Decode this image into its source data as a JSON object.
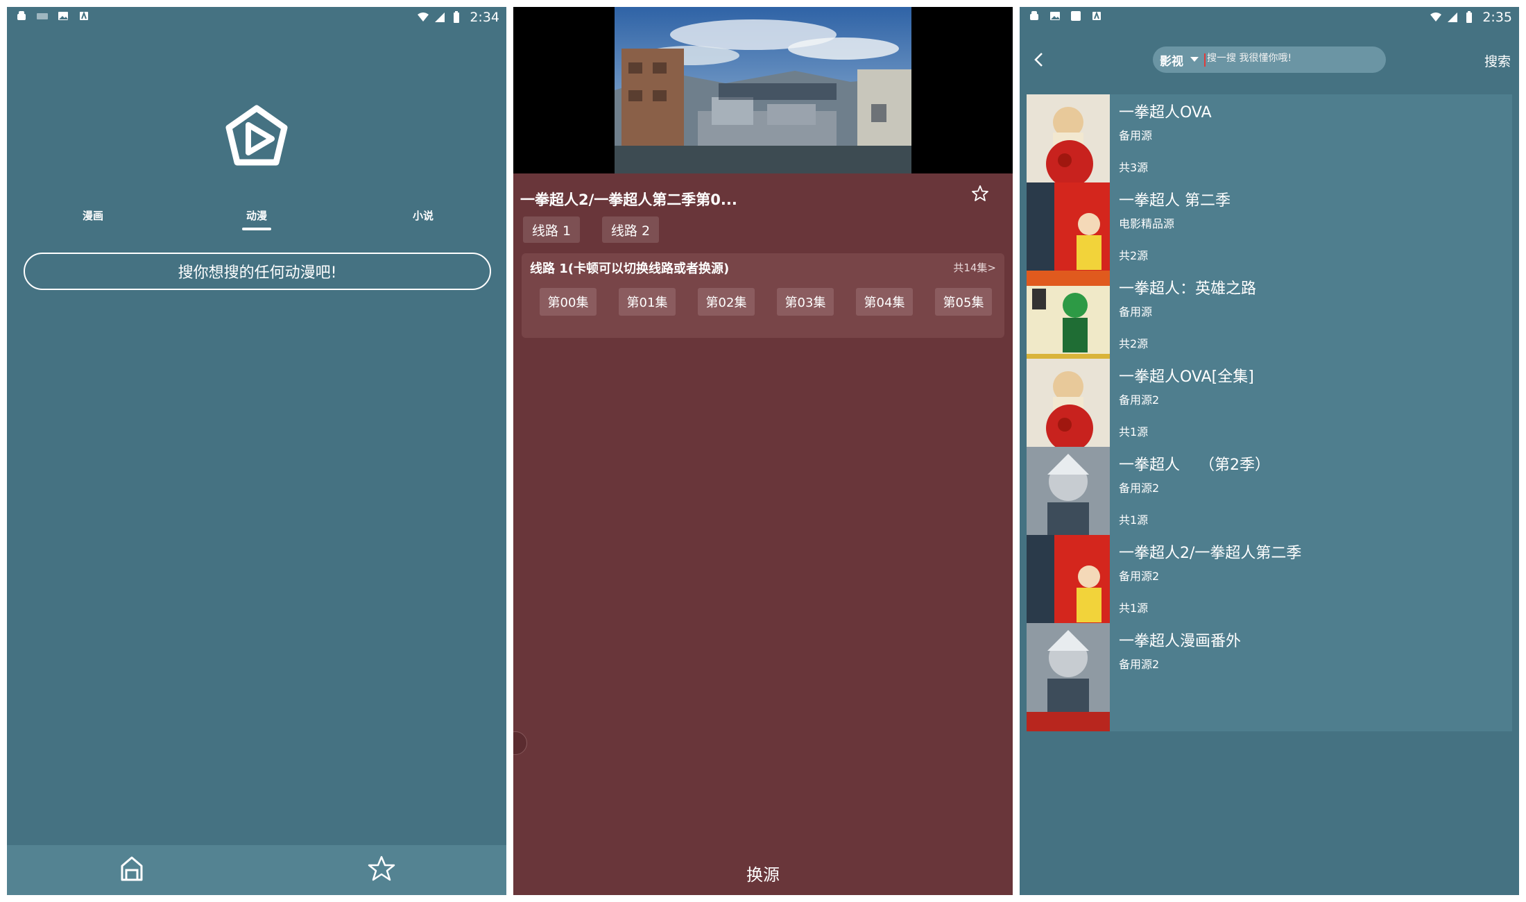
{
  "status_left": {
    "time": "2:34"
  },
  "status_right": {
    "time": "2:35"
  },
  "home": {
    "tabs": [
      "漫画",
      "动漫",
      "小说"
    ],
    "selected_tab": "动漫",
    "search_prompt": "搜你想搜的任何动漫吧!"
  },
  "player": {
    "title": "一拳超人2/一拳超人第二季第0...",
    "routes": [
      "线路 1",
      "线路 2"
    ],
    "card_title": "线路 1(卡顿可以切换线路或者换源)",
    "card_count": "共14集>",
    "episodes": [
      "第00集",
      "第01集",
      "第02集",
      "第03集",
      "第04集",
      "第05集"
    ],
    "change_source": "换源"
  },
  "search": {
    "category": "影视",
    "placeholder": "搜一搜 我很懂你哦!",
    "action": "搜索",
    "results": [
      {
        "title": "一拳超人OVA",
        "source": "备用源",
        "count": "共3源",
        "thumb": "red"
      },
      {
        "title": "一拳超人 第二季",
        "source": "电影精品源",
        "count": "共2源",
        "thumb": "poster"
      },
      {
        "title": "一拳超人：英雄之路",
        "source": "备用源",
        "count": "共2源",
        "thumb": "manga"
      },
      {
        "title": "一拳超人OVA[全集]",
        "source": "备用源2",
        "count": "共1源",
        "thumb": "red"
      },
      {
        "title": "一拳超人    （第2季）",
        "source": "备用源2",
        "count": "共1源",
        "thumb": "garou"
      },
      {
        "title": "一拳超人2/一拳超人第二季",
        "source": "备用源2",
        "count": "共1源",
        "thumb": "poster"
      },
      {
        "title": "一拳超人漫画番外",
        "source": "备用源2",
        "count": "",
        "thumb": "garou"
      }
    ]
  },
  "colors": {
    "teal": "#457282",
    "maroon": "#69363a",
    "card_teal": "#4f7e8e",
    "card_maroon": "#784548"
  }
}
